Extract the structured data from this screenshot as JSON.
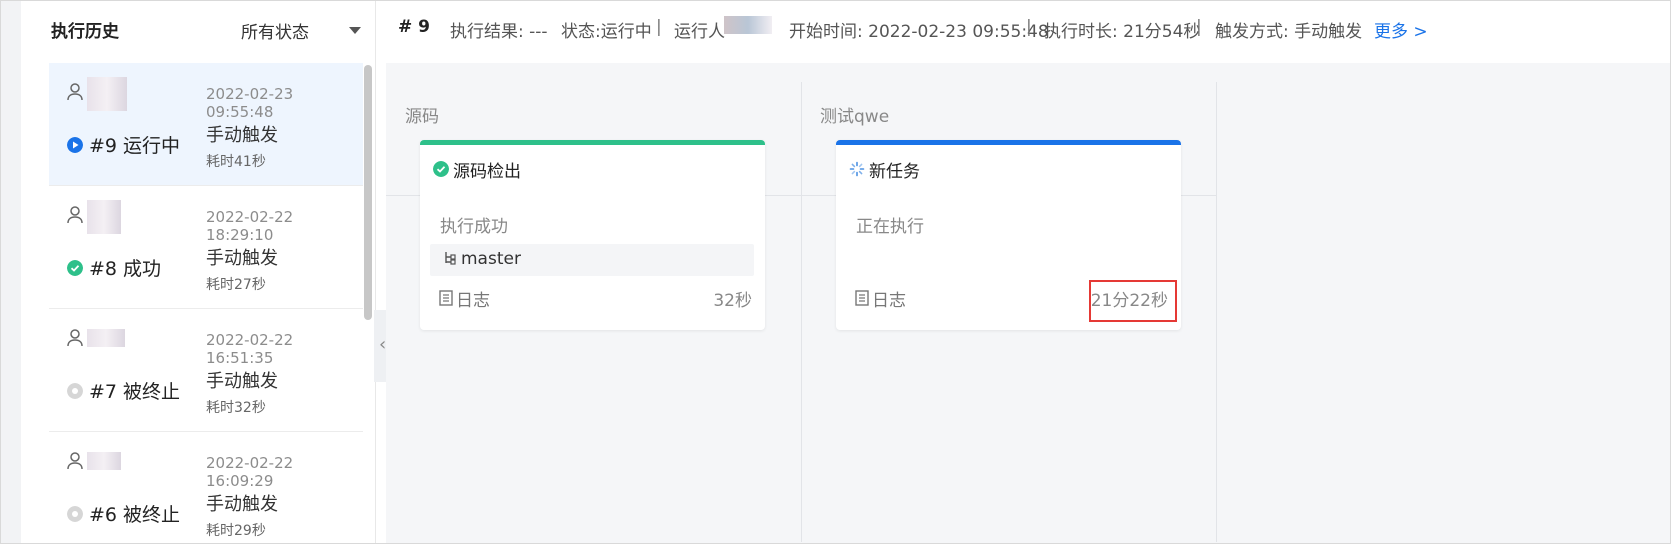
{
  "sidebar": {
    "title": "执行历史",
    "filter_label": "所有状态",
    "runs": [
      {
        "time": "2022-02-23 09:55:48",
        "label": "#9 运行中",
        "trigger": "手动触发",
        "duration": "耗时41秒",
        "status": "running",
        "status_color": "#1a73e8"
      },
      {
        "time": "2022-02-22 18:29:10",
        "label": "#8 成功",
        "trigger": "手动触发",
        "duration": "耗时27秒",
        "status": "success",
        "status_color": "#2ec08a"
      },
      {
        "time": "2022-02-22 16:51:35",
        "label": "#7 被终止",
        "trigger": "手动触发",
        "duration": "耗时32秒",
        "status": "terminated",
        "status_color": "#d0d0d0"
      },
      {
        "time": "2022-02-22 16:09:29",
        "label": "#6 被终止",
        "trigger": "手动触发",
        "duration": "耗时29秒",
        "status": "terminated",
        "status_color": "#d0d0d0"
      }
    ]
  },
  "header": {
    "run_number": "# 9",
    "result": "执行结果: ---",
    "state": "状态:运行中",
    "runner_label": "运行人",
    "start_time": "开始时间: 2022-02-23 09:55:48",
    "duration": "执行时长: 21分54秒",
    "trigger": "触发方式: 手动触发",
    "more": "更多 >",
    "separator": "|"
  },
  "stages": [
    {
      "title": "源码",
      "card": {
        "title": "源码检出",
        "status": "执行成功",
        "branch": "master",
        "log_label": "日志",
        "duration": "32秒",
        "accent": "#2ec08a",
        "icon": "check-circle-icon"
      }
    },
    {
      "title": "测试qwe",
      "card": {
        "title": "新任务",
        "status": "正在执行",
        "log_label": "日志",
        "duration": "21分22秒",
        "accent": "#1a73e8",
        "icon": "spinner-icon"
      }
    }
  ]
}
